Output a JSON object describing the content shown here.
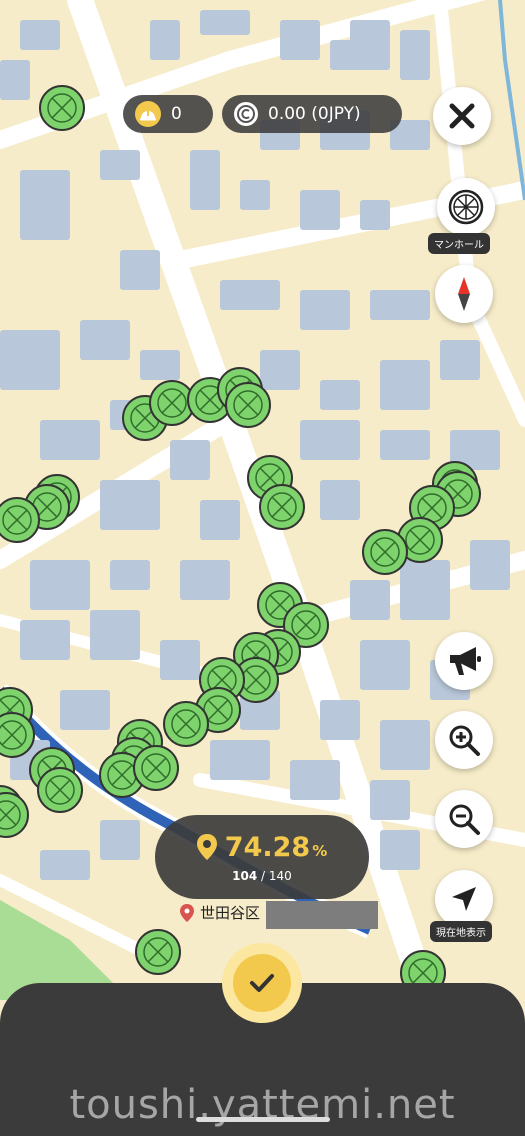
{
  "status_bar": {
    "helmet_count": "0",
    "balance": "0.00 (0JPY)"
  },
  "buttons": {
    "close_icon": "close-icon",
    "manhole_label": "マンホール",
    "compass_icon": "compass-icon",
    "announce_icon": "megaphone-icon",
    "zoom_in_icon": "zoom-in-icon",
    "zoom_out_icon": "zoom-out-icon",
    "current_location_label": "現在地表示"
  },
  "progress": {
    "percent": "74.28",
    "percent_unit": "%",
    "found": "104",
    "separator": " / ",
    "total": "140"
  },
  "location": {
    "area": "世田谷区"
  },
  "watermark": "toushi.yattemi.net",
  "colors": {
    "map_background": "#f6ecc9",
    "building": "#b8c7d9",
    "road": "#ffffff",
    "river": "#2e63b8",
    "park": "#a9dc95",
    "manhole_fill": "#7ed36d",
    "accent_yellow": "#f2c94c",
    "dark_panel": "#3b3b3b"
  }
}
